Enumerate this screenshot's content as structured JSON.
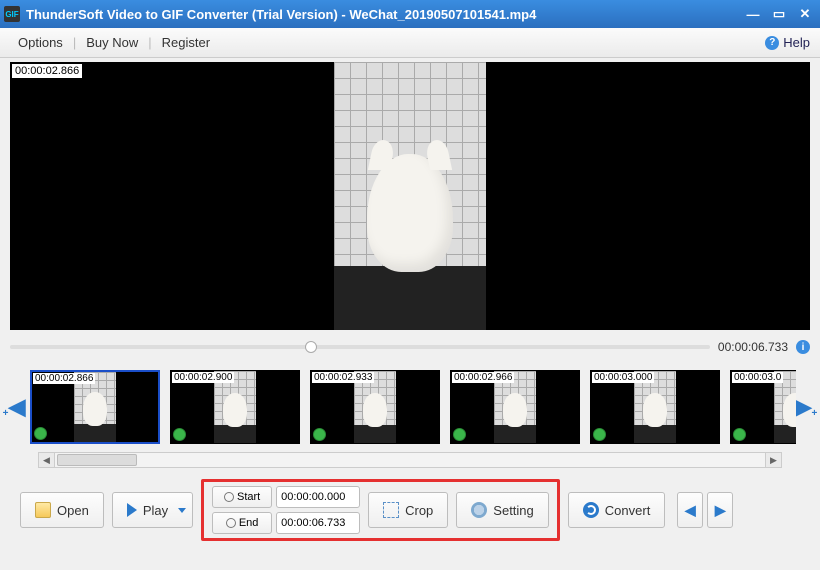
{
  "window": {
    "title": "ThunderSoft Video to GIF Converter (Trial Version) - WeChat_20190507101541.mp4"
  },
  "menubar": {
    "options": "Options",
    "buy_now": "Buy Now",
    "register": "Register",
    "help": "Help"
  },
  "preview": {
    "timestamp": "00:00:02.866"
  },
  "seekbar": {
    "duration": "00:00:06.733"
  },
  "thumbnails": [
    {
      "time": "00:00:02.866",
      "selected": true
    },
    {
      "time": "00:00:02.900",
      "selected": false
    },
    {
      "time": "00:00:02.933",
      "selected": false
    },
    {
      "time": "00:00:02.966",
      "selected": false
    },
    {
      "time": "00:00:03.000",
      "selected": false
    },
    {
      "time": "00:00:03.0",
      "selected": false
    }
  ],
  "toolbar": {
    "open": "Open",
    "play": "Play",
    "start": "Start",
    "start_value": "00:00:00.000",
    "end": "End",
    "end_value": "00:00:06.733",
    "crop": "Crop",
    "setting": "Setting",
    "convert": "Convert"
  }
}
